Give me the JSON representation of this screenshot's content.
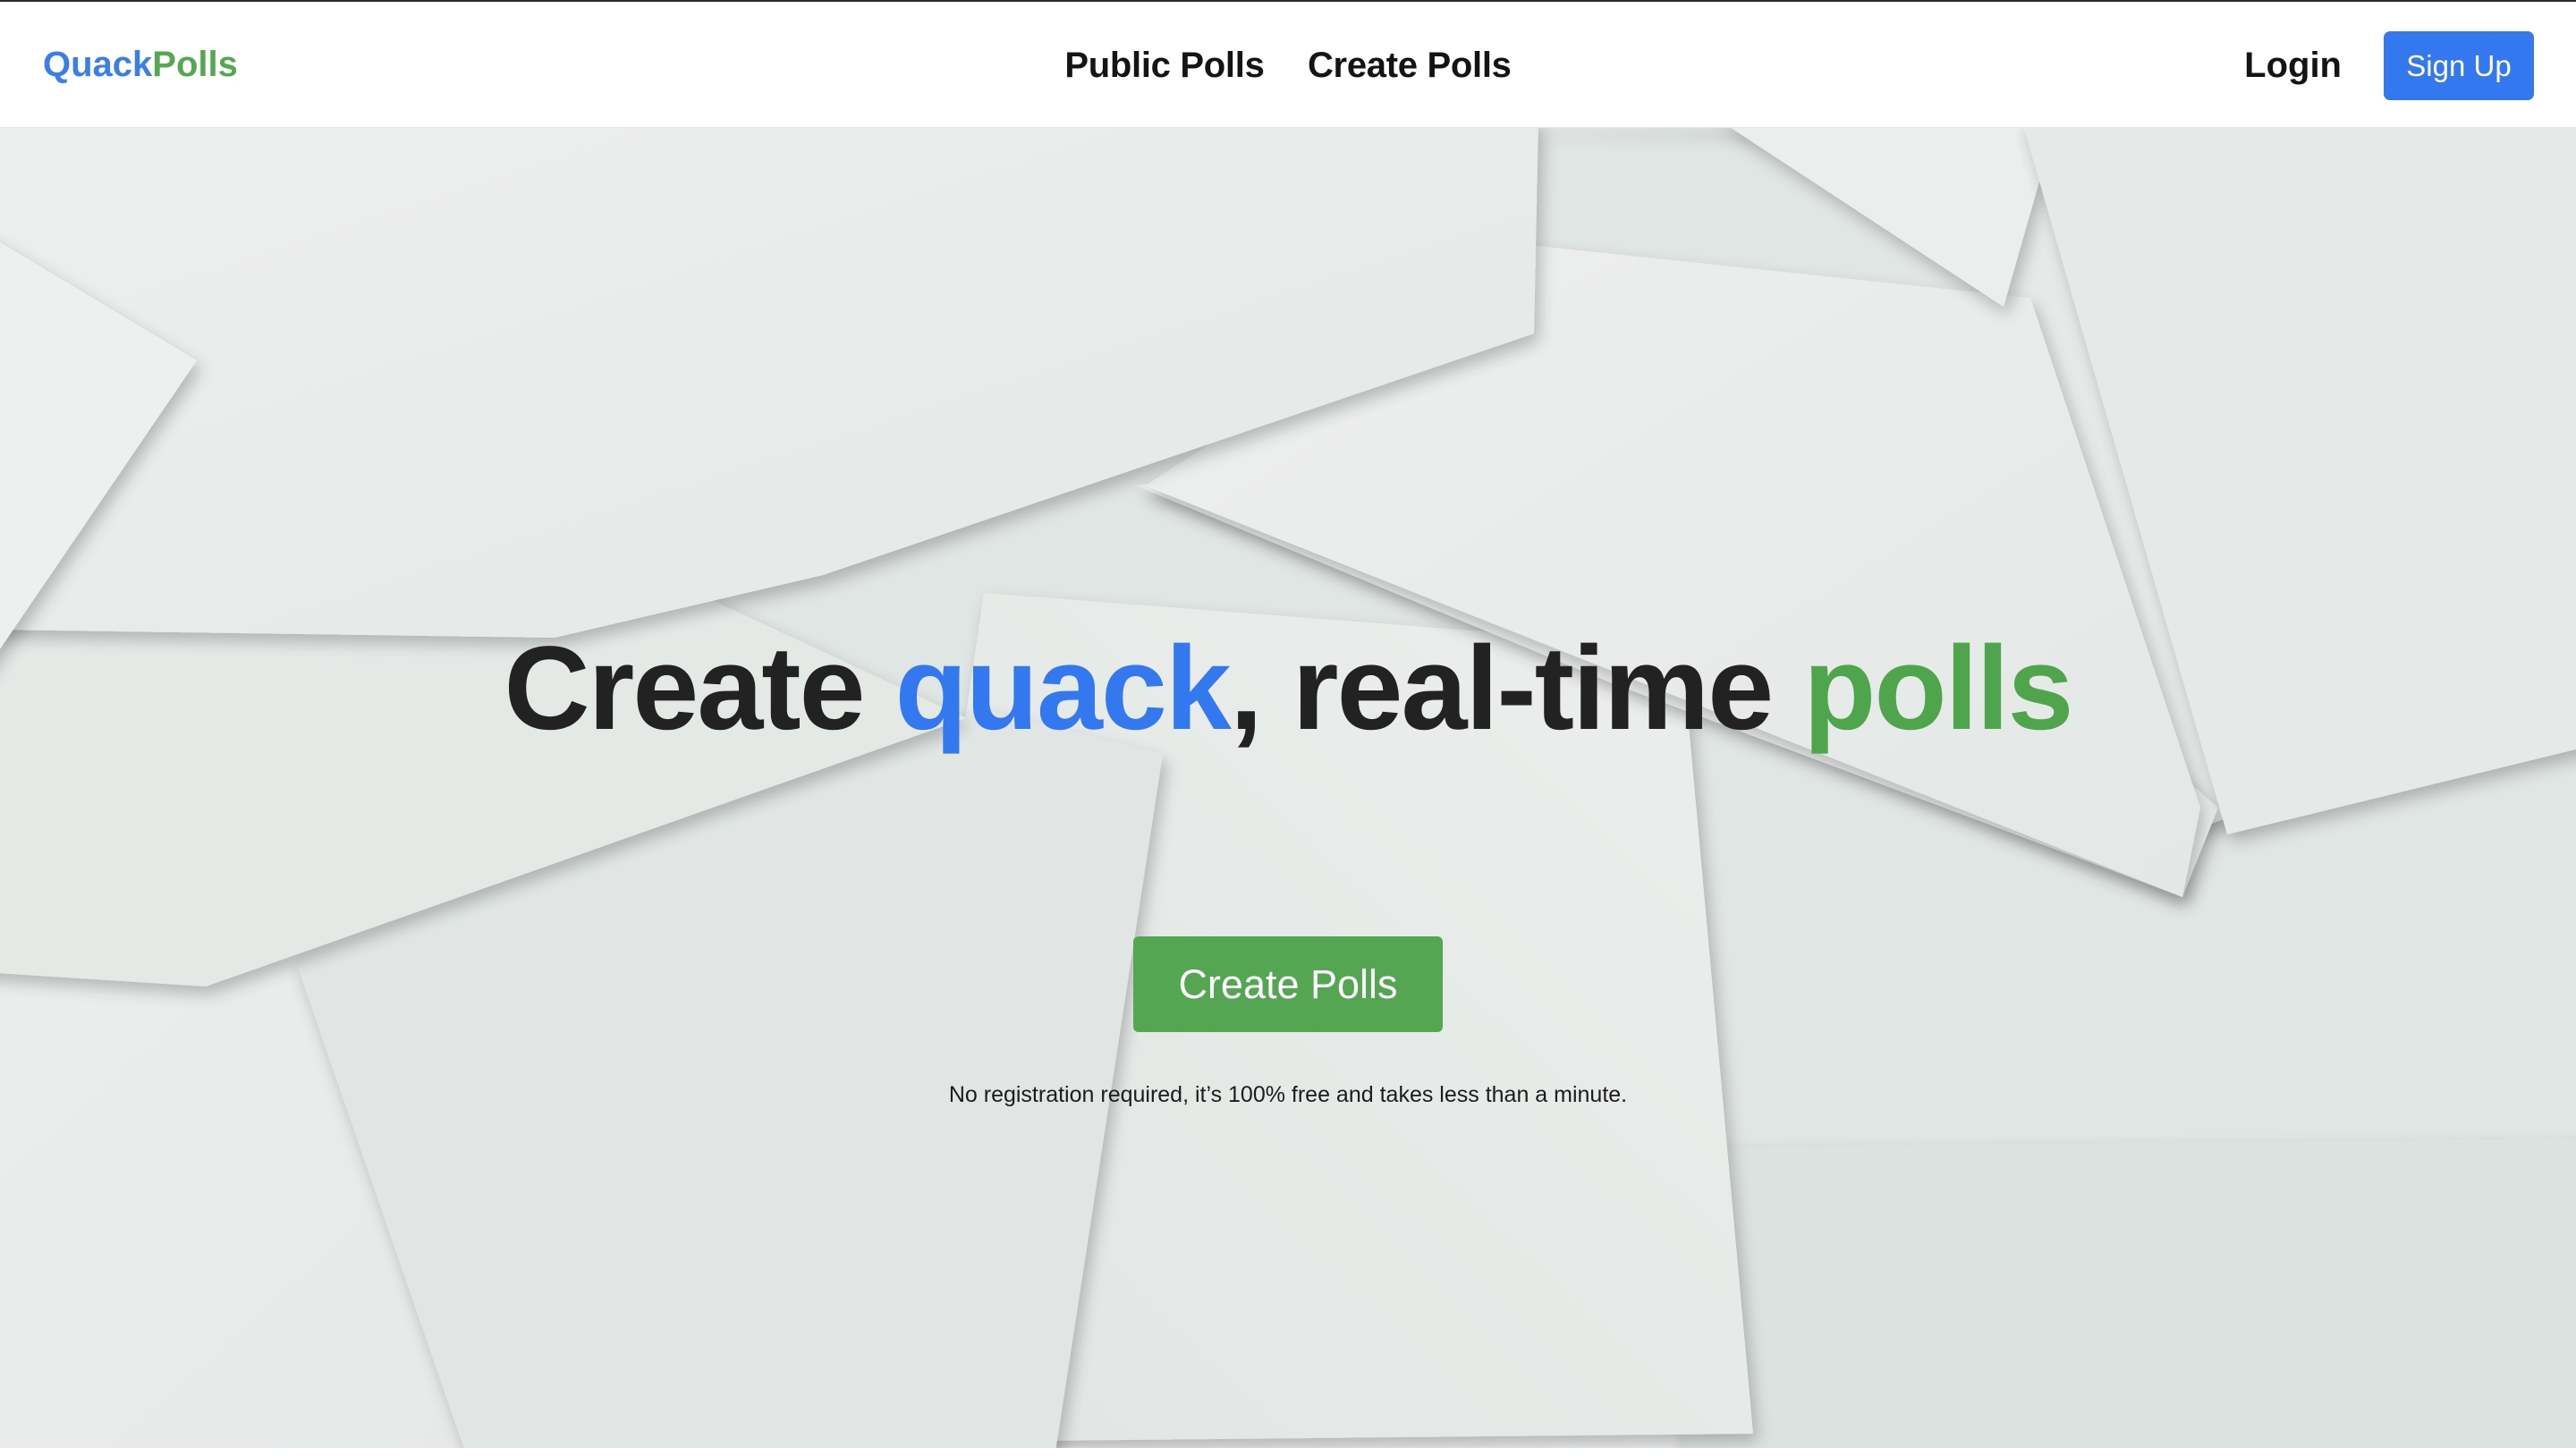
{
  "brand": {
    "part1": "Quack",
    "part2": "Polls",
    "color_primary": "#3a7ee8",
    "color_secondary": "#55a852"
  },
  "nav": {
    "public_polls": "Public Polls",
    "create_polls": "Create Polls",
    "login": "Login",
    "signup": "Sign Up"
  },
  "hero": {
    "headline_part1": "Create ",
    "headline_highlight1": "quack",
    "headline_part2": ", real-time ",
    "headline_highlight2": "polls",
    "cta_label": "Create Polls",
    "note": "No registration required, it’s 100% free and takes less than a minute.",
    "background": "scattered-white-paper-sheets"
  },
  "colors": {
    "accent_blue": "#3478f0",
    "accent_green": "#55a652",
    "text_dark": "#222222"
  }
}
